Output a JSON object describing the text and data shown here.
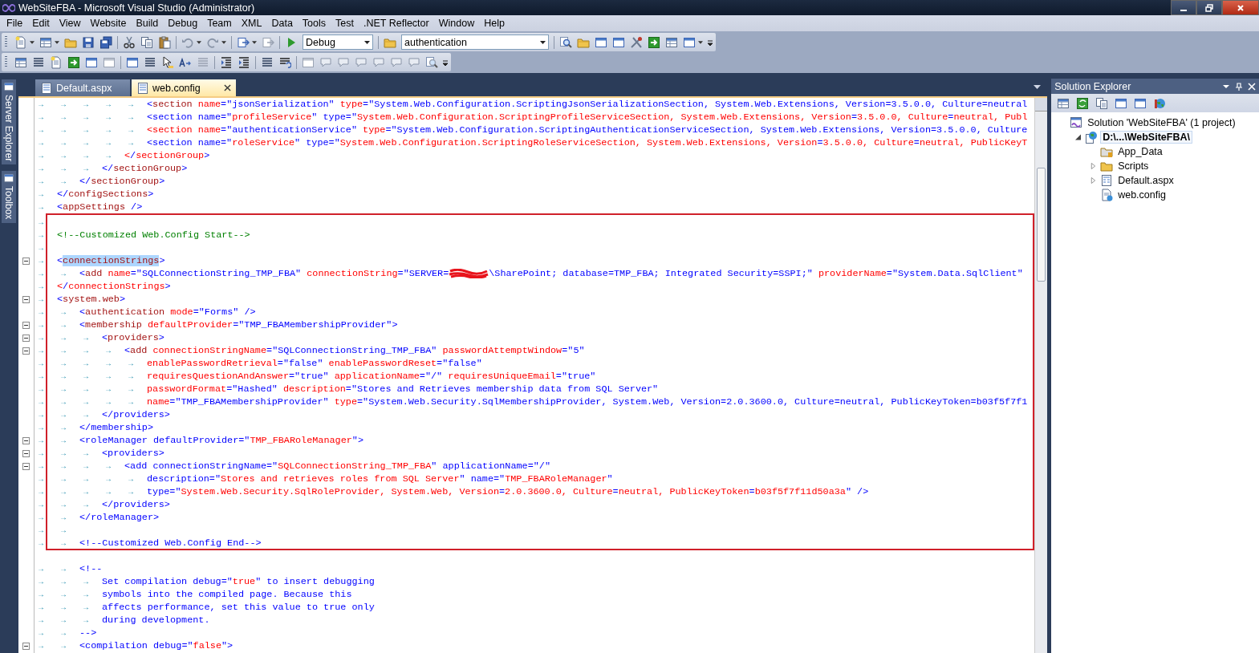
{
  "window": {
    "title": "WebSiteFBA - Microsoft Visual Studio (Administrator)"
  },
  "menu": [
    "File",
    "Edit",
    "View",
    "Website",
    "Build",
    "Debug",
    "Team",
    "XML",
    "Data",
    "Tools",
    "Test",
    ".NET Reflector",
    "Window",
    "Help"
  ],
  "toolbar": {
    "configuration_combo": {
      "value": "Debug"
    },
    "find_combo": {
      "value": "authentication"
    }
  },
  "side_tabs": [
    {
      "label": "Server Explorer"
    },
    {
      "label": "Toolbox"
    }
  ],
  "tabs": [
    {
      "label": "Default.aspx",
      "selected": false
    },
    {
      "label": "web.config",
      "selected": true
    }
  ],
  "editor": {
    "lines_before": [
      {
        "tabs": "→ → → → →",
        "fold": false,
        "code": [
          {
            "kind": "plain",
            "text": "<section name=\"jsonSerialization\" type=\"System.Web.Configuration.ScriptingJsonSerializationSection, System.Web.Extensions, Version=3.5.0.0, Culture=neutral"
          }
        ]
      },
      {
        "tabs": "→ → → → →",
        "fold": false,
        "code": [
          {
            "kind": "plain",
            "text": "<section name=\"profileService\" type=\"System.Web.Configuration.ScriptingProfileServiceSection, System.Web.Extensions, Version=3.5.0.0, Culture=neutral, Publ"
          }
        ]
      },
      {
        "tabs": "→ → → → →",
        "fold": false,
        "code": [
          {
            "kind": "plain",
            "text": "<section name=\"authenticationService\" type=\"System.Web.Configuration.ScriptingAuthenticationServiceSection, System.Web.Extensions, Version=3.5.0.0, Culture"
          }
        ]
      },
      {
        "tabs": "→ → → → →",
        "fold": false,
        "code": [
          {
            "kind": "plain",
            "text": "<section name=\"roleService\" type=\"System.Web.Configuration.ScriptingRoleServiceSection, System.Web.Extensions, Version=3.5.0.0, Culture=neutral, PublicKeyT"
          }
        ]
      },
      {
        "tabs": "→ → → →",
        "fold": false,
        "code": [
          {
            "kind": "plain",
            "text": "</sectionGroup>"
          }
        ]
      },
      {
        "tabs": "→ → →",
        "fold": false,
        "code": [
          {
            "kind": "plain",
            "text": "</sectionGroup>"
          }
        ]
      },
      {
        "tabs": "→ →",
        "fold": false,
        "code": [
          {
            "kind": "plain",
            "text": "</sectionGroup>"
          }
        ]
      },
      {
        "tabs": "→",
        "fold": false,
        "code": [
          {
            "kind": "plain",
            "text": "</configSections>"
          }
        ]
      },
      {
        "tabs": "→",
        "fold": false,
        "code": [
          {
            "kind": "plain",
            "text": "<appSettings />"
          }
        ]
      }
    ],
    "boxed_lines": [
      {
        "tabs": "→",
        "fold": false
      },
      {
        "tabs": "→",
        "fold": false,
        "code": [
          {
            "kind": "plain",
            "text": "<!--Customized Web.Config Start-->"
          }
        ]
      },
      {
        "tabs": "→",
        "fold": false
      },
      {
        "tabs": "→",
        "fold": true,
        "code": [
          {
            "kind": "plain",
            "text": "<"
          },
          {
            "kind": "selected",
            "text": "connectionStrings"
          },
          {
            "kind": "plain",
            "text": ">"
          }
        ]
      },
      {
        "tabs": "→ →",
        "fold": false,
        "code": [
          {
            "kind": "plain",
            "text": "<add name=\"SQLConnectionString_TMP_FBA\" connectionString=\"SERVER="
          },
          {
            "kind": "redacted"
          },
          {
            "kind": "plain",
            "text": "\\SharePoint; database=TMP_FBA; Integrated Security=SSPI;\" providerName=\"System.Data.SqlClient\""
          }
        ]
      },
      {
        "tabs": "→",
        "fold": false,
        "code": [
          {
            "kind": "plain",
            "text": "</connectionStrings>"
          }
        ]
      },
      {
        "tabs": "→",
        "fold": true,
        "code": [
          {
            "kind": "plain",
            "text": "<system.web>"
          }
        ]
      },
      {
        "tabs": "→ →",
        "fold": false,
        "code": [
          {
            "kind": "plain",
            "text": "<authentication mode=\"Forms\" />"
          }
        ]
      },
      {
        "tabs": "→ →",
        "fold": true,
        "code": [
          {
            "kind": "plain",
            "text": "<membership defaultProvider=\"TMP_FBAMembershipProvider\">"
          }
        ]
      },
      {
        "tabs": "→ → →",
        "fold": true,
        "code": [
          {
            "kind": "plain",
            "text": "<providers>"
          }
        ]
      },
      {
        "tabs": "→ → → →",
        "fold": true,
        "code": [
          {
            "kind": "plain",
            "text": "<add connectionStringName=\"SQLConnectionString_TMP_FBA\" passwordAttemptWindow=\"5\""
          }
        ]
      },
      {
        "tabs": "→ → → → →",
        "fold": false,
        "code": [
          {
            "kind": "plain",
            "text": "enablePasswordRetrieval=\"false\" enablePasswordReset=\"false\""
          }
        ]
      },
      {
        "tabs": "→ → → → →",
        "fold": false,
        "code": [
          {
            "kind": "plain",
            "text": "requiresQuestionAndAnswer=\"true\" applicationName=\"/\" requiresUniqueEmail=\"true\""
          }
        ]
      },
      {
        "tabs": "→ → → → →",
        "fold": false,
        "code": [
          {
            "kind": "plain",
            "text": "passwordFormat=\"Hashed\" description=\"Stores and Retrieves membership data from SQL Server\""
          }
        ]
      },
      {
        "tabs": "→ → → → →",
        "fold": false,
        "code": [
          {
            "kind": "plain",
            "text": "name=\"TMP_FBAMembershipProvider\" type=\"System.Web.Security.SqlMembershipProvider, System.Web, Version=2.0.3600.0, Culture=neutral, PublicKeyToken=b03f5f7f1"
          }
        ]
      },
      {
        "tabs": "→ → →",
        "fold": false,
        "code": [
          {
            "kind": "plain",
            "text": "</providers>"
          }
        ]
      },
      {
        "tabs": "→ →",
        "fold": false,
        "code": [
          {
            "kind": "plain",
            "text": "</membership>"
          }
        ]
      },
      {
        "tabs": "→ →",
        "fold": true,
        "code": [
          {
            "kind": "plain",
            "text": "<roleManager defaultProvider=\"TMP_FBARoleManager\">"
          }
        ]
      },
      {
        "tabs": "→ → →",
        "fold": true,
        "code": [
          {
            "kind": "plain",
            "text": "<providers>"
          }
        ]
      },
      {
        "tabs": "→ → → →",
        "fold": true,
        "code": [
          {
            "kind": "plain",
            "text": "<add connectionStringName=\"SQLConnectionString_TMP_FBA\" applicationName=\"/\""
          }
        ]
      },
      {
        "tabs": "→ → → → →",
        "fold": false,
        "code": [
          {
            "kind": "plain",
            "text": "description=\"Stores and retrieves roles from SQL Server\" name=\"TMP_FBARoleManager\""
          }
        ]
      },
      {
        "tabs": "→ → → → →",
        "fold": false,
        "code": [
          {
            "kind": "plain",
            "text": "type=\"System.Web.Security.SqlRoleProvider, System.Web, Version=2.0.3600.0, Culture=neutral, PublicKeyToken=b03f5f7f11d50a3a\" />"
          }
        ]
      },
      {
        "tabs": "→ → →",
        "fold": false,
        "code": [
          {
            "kind": "plain",
            "text": "</providers>"
          }
        ]
      },
      {
        "tabs": "→ →",
        "fold": false,
        "code": [
          {
            "kind": "plain",
            "text": "</roleManager>"
          }
        ]
      },
      {
        "tabs": "→ →",
        "fold": false
      },
      {
        "tabs": "→ →",
        "fold": false,
        "code": [
          {
            "kind": "plain",
            "text": "<!--Customized Web.Config End-->"
          }
        ]
      }
    ],
    "lines_after": [
      {
        "tabs": "→ →",
        "fold": false,
        "code": [
          {
            "kind": "plain",
            "text": "<!--"
          }
        ]
      },
      {
        "tabs": "→ → →",
        "fold": false,
        "code": [
          {
            "kind": "plain",
            "text": "Set compilation debug=\"true\" to insert debugging"
          }
        ]
      },
      {
        "tabs": "→ → →",
        "fold": false,
        "code": [
          {
            "kind": "plain",
            "text": "symbols into the compiled page. Because this"
          }
        ]
      },
      {
        "tabs": "→ → →",
        "fold": false,
        "code": [
          {
            "kind": "plain",
            "text": "affects performance, set this value to true only"
          }
        ]
      },
      {
        "tabs": "→ → →",
        "fold": false,
        "code": [
          {
            "kind": "plain",
            "text": "during development."
          }
        ]
      },
      {
        "tabs": "→ →",
        "fold": false,
        "code": [
          {
            "kind": "plain",
            "text": "-->"
          }
        ]
      },
      {
        "tabs": "→ →",
        "fold": true,
        "code": [
          {
            "kind": "plain",
            "text": "<compilation debug=\"false\">"
          }
        ]
      }
    ]
  },
  "solution_explorer": {
    "title": "Solution Explorer",
    "tree": [
      {
        "label": "Solution 'WebSiteFBA' (1 project)",
        "kind": "solution",
        "selected": false,
        "children": [
          {
            "label": "D:\\...\\WebSiteFBA\\",
            "kind": "project",
            "selected": true,
            "expanded": true,
            "children": [
              {
                "label": "App_Data",
                "kind": "special-folder",
                "selected": false
              },
              {
                "label": "Scripts",
                "kind": "folder",
                "selected": false,
                "expanded": false
              },
              {
                "label": "Default.aspx",
                "kind": "page",
                "selected": false,
                "expanded": false
              },
              {
                "label": "web.config",
                "kind": "config",
                "selected": false
              }
            ]
          }
        ]
      }
    ]
  }
}
